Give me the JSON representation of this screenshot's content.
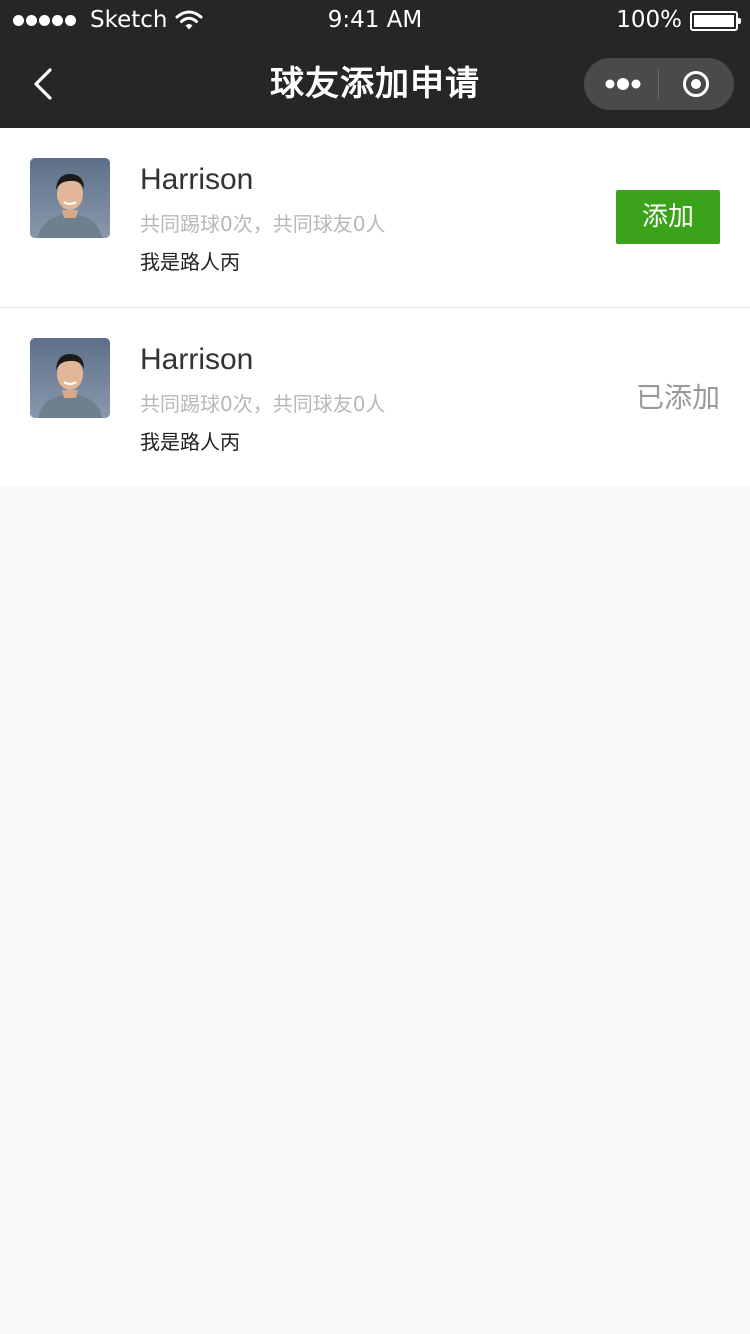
{
  "status_bar": {
    "carrier": "Sketch",
    "time": "9:41 AM",
    "battery": "100%"
  },
  "nav": {
    "title": "球友添加申请",
    "back_icon": "chevron-left-icon",
    "more_icon": "more-dots-icon",
    "close_icon": "target-circle-icon"
  },
  "requests": [
    {
      "name": "Harrison",
      "stats": "共同踢球0次，共同球友0人",
      "note": "我是路人丙",
      "action": "添加"
    },
    {
      "name": "Harrison",
      "stats": "共同踢球0次，共同球友0人",
      "note": "我是路人丙",
      "status": "已添加"
    }
  ],
  "colors": {
    "bar_bg": "#262626",
    "accent": "#3aa31a",
    "page_bg": "#f8f8f8"
  }
}
